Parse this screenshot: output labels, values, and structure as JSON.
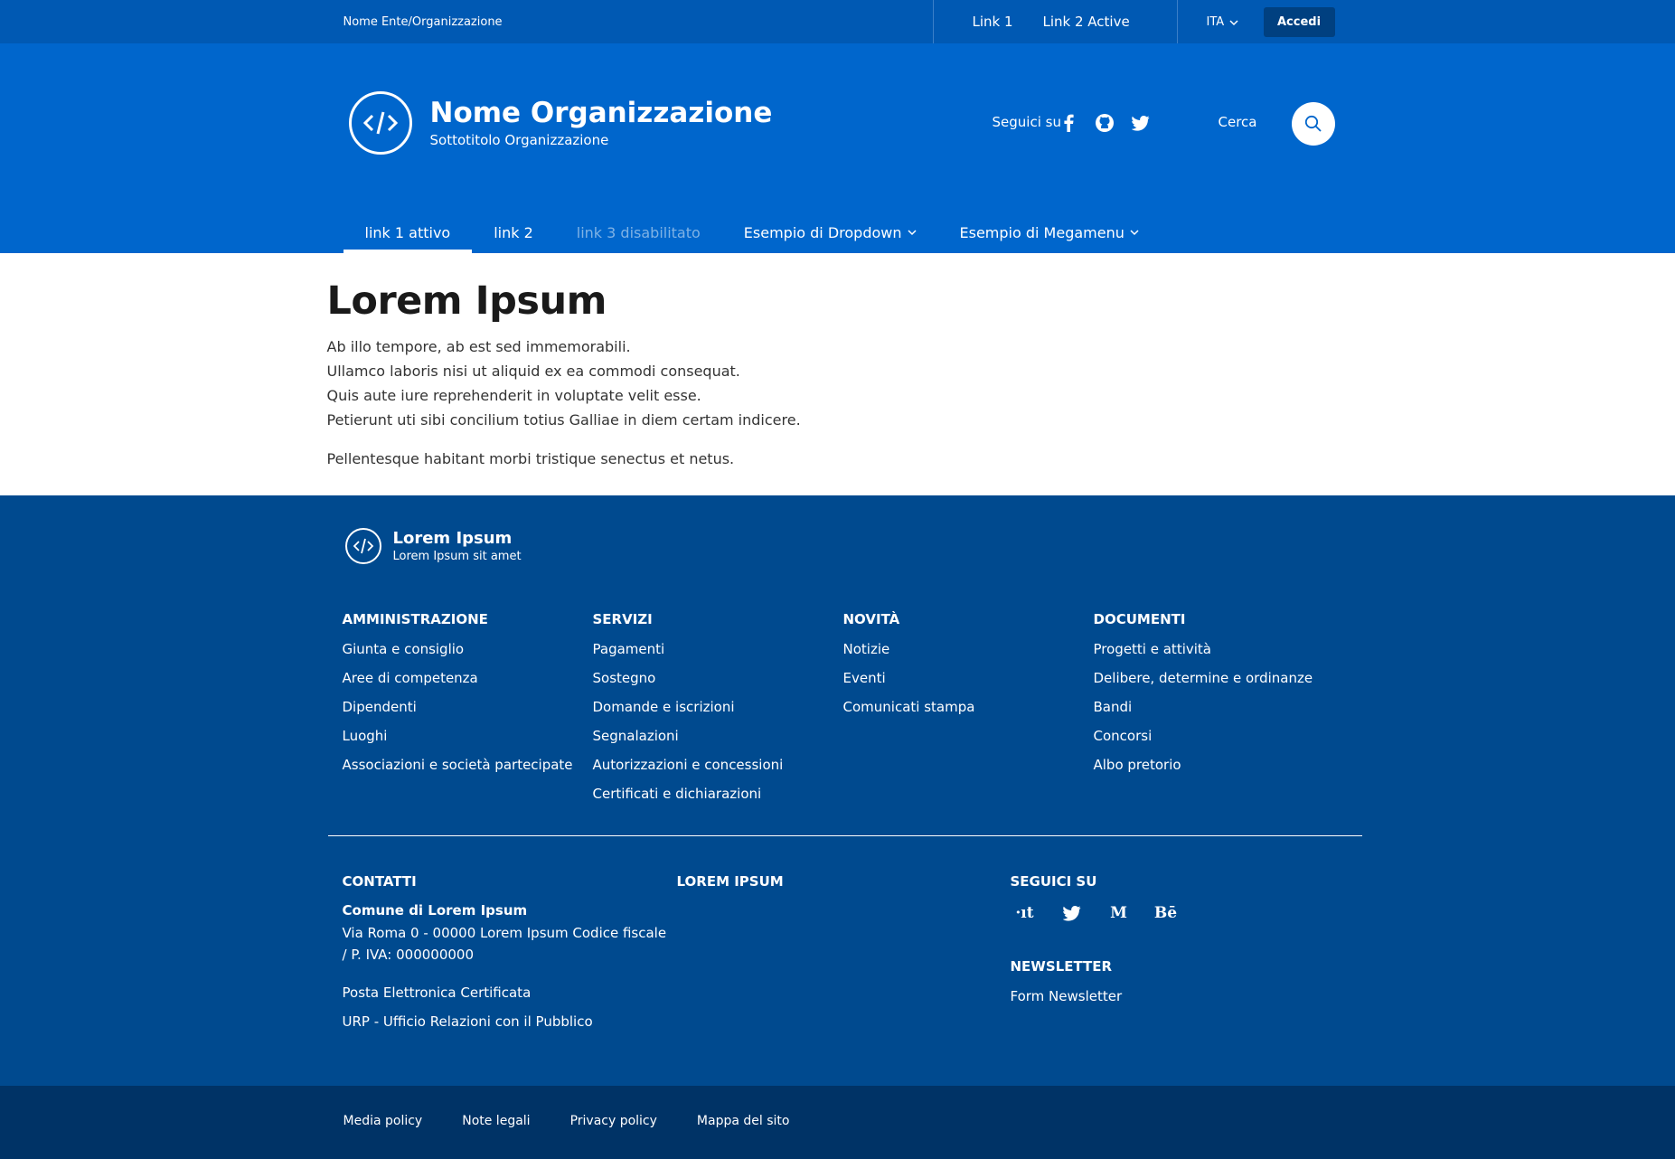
{
  "slim_header": {
    "org_name": "Nome Ente/Organizzazione",
    "link1": "Link 1",
    "link2": "Link 2 Active",
    "language": "ITA",
    "login": "Accedi"
  },
  "center_header": {
    "title": "Nome Organizzazione",
    "subtitle": "Sottotitolo Organizzazione",
    "follow_label": "Seguici su",
    "social_icons": [
      "facebook-icon",
      "github-icon",
      "twitter-icon"
    ],
    "search_label": "Cerca"
  },
  "nav": {
    "items": [
      {
        "label": "link 1 attivo",
        "state": "active"
      },
      {
        "label": "link 2",
        "state": "normal"
      },
      {
        "label": "link 3 disabilitato",
        "state": "disabled"
      },
      {
        "label": "Esempio di Dropdown",
        "state": "dropdown"
      },
      {
        "label": "Esempio di Megamenu",
        "state": "dropdown"
      }
    ]
  },
  "main": {
    "title": "Lorem Ipsum",
    "lines": [
      "Ab illo tempore, ab est sed immemorabili.",
      "Ullamco laboris nisi ut aliquid ex ea commodi consequat.",
      "Quis aute iure reprehenderit in voluptate velit esse.",
      "Petierunt uti sibi concilium totius Galliae in diem certam indicere."
    ],
    "paragraph2": "Pellentesque habitant morbi tristique senectus et netus."
  },
  "footer": {
    "brand_title": "Lorem Ipsum",
    "brand_sub": "Lorem Ipsum sit amet",
    "columns": [
      {
        "title": "AMMINISTRAZIONE",
        "links": [
          "Giunta e consiglio",
          "Aree di competenza",
          "Dipendenti",
          "Luoghi",
          "Associazioni e società partecipate"
        ]
      },
      {
        "title": "SERVIZI",
        "links": [
          "Pagamenti",
          "Sostegno",
          "Domande e iscrizioni",
          "Segnalazioni",
          "Autorizzazioni e concessioni",
          "Certificati e dichiarazioni"
        ]
      },
      {
        "title": "NOVITÀ",
        "links": [
          "Notizie",
          "Eventi",
          "Comunicati stampa"
        ]
      },
      {
        "title": "DOCUMENTI",
        "links": [
          "Progetti e attività",
          "Delibere, determine e ordinanze",
          "Bandi",
          "Concorsi",
          "Albo pretorio"
        ]
      }
    ],
    "contacts": {
      "title": "CONTATTI",
      "name": "Comune di Lorem Ipsum",
      "address": "Via Roma 0 - 00000 Lorem Ipsum Codice fiscale / P. IVA: 000000000",
      "links": [
        "Posta Elettronica Certificata",
        "URP - Ufficio Relazioni con il Pubblico"
      ]
    },
    "lorem_title": "LOREM IPSUM",
    "follow": {
      "title": "SEGUICI SU",
      "icons": [
        {
          "name": "designers-italia-icon",
          "glyph": "·ıt"
        },
        {
          "name": "twitter-icon",
          "glyph": ""
        },
        {
          "name": "medium-icon",
          "glyph": "M"
        },
        {
          "name": "behance-icon",
          "glyph": "Bē"
        }
      ]
    },
    "newsletter": {
      "title": "NEWSLETTER",
      "link": "Form Newsletter"
    },
    "bottom_links": [
      "Media policy",
      "Note legali",
      "Privacy policy",
      "Mappa del sito"
    ]
  },
  "colors": {
    "slim": "#0059b3",
    "primary": "#0066cc",
    "footer": "#004a8f",
    "footer_bottom": "#003366"
  }
}
